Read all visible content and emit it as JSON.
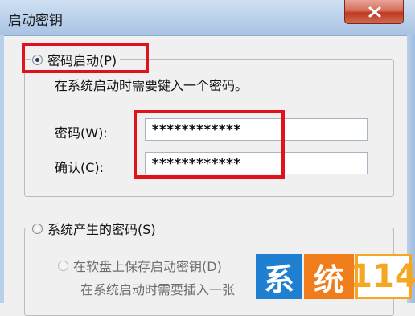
{
  "window": {
    "title": "启动密钥"
  },
  "option_password": {
    "label": "密码启动(P)",
    "description": "在系统启动时需要键入一个密码。",
    "selected": true,
    "password_label": "密码(W):",
    "password_value": "************",
    "confirm_label": "确认(C):",
    "confirm_value": "************"
  },
  "option_system": {
    "label": "系统产生的密码(S)",
    "selected": false,
    "sub_option_label": "在软盘上保存启动密钥(D)",
    "sub_description": "在系统启动时需要插入一张"
  },
  "watermark": {
    "char1": "系",
    "char2": "统",
    "number": "114"
  },
  "colors": {
    "highlight": "#e0121c",
    "close_button": "#c0391f",
    "titlebar": "#b9d0ea"
  }
}
